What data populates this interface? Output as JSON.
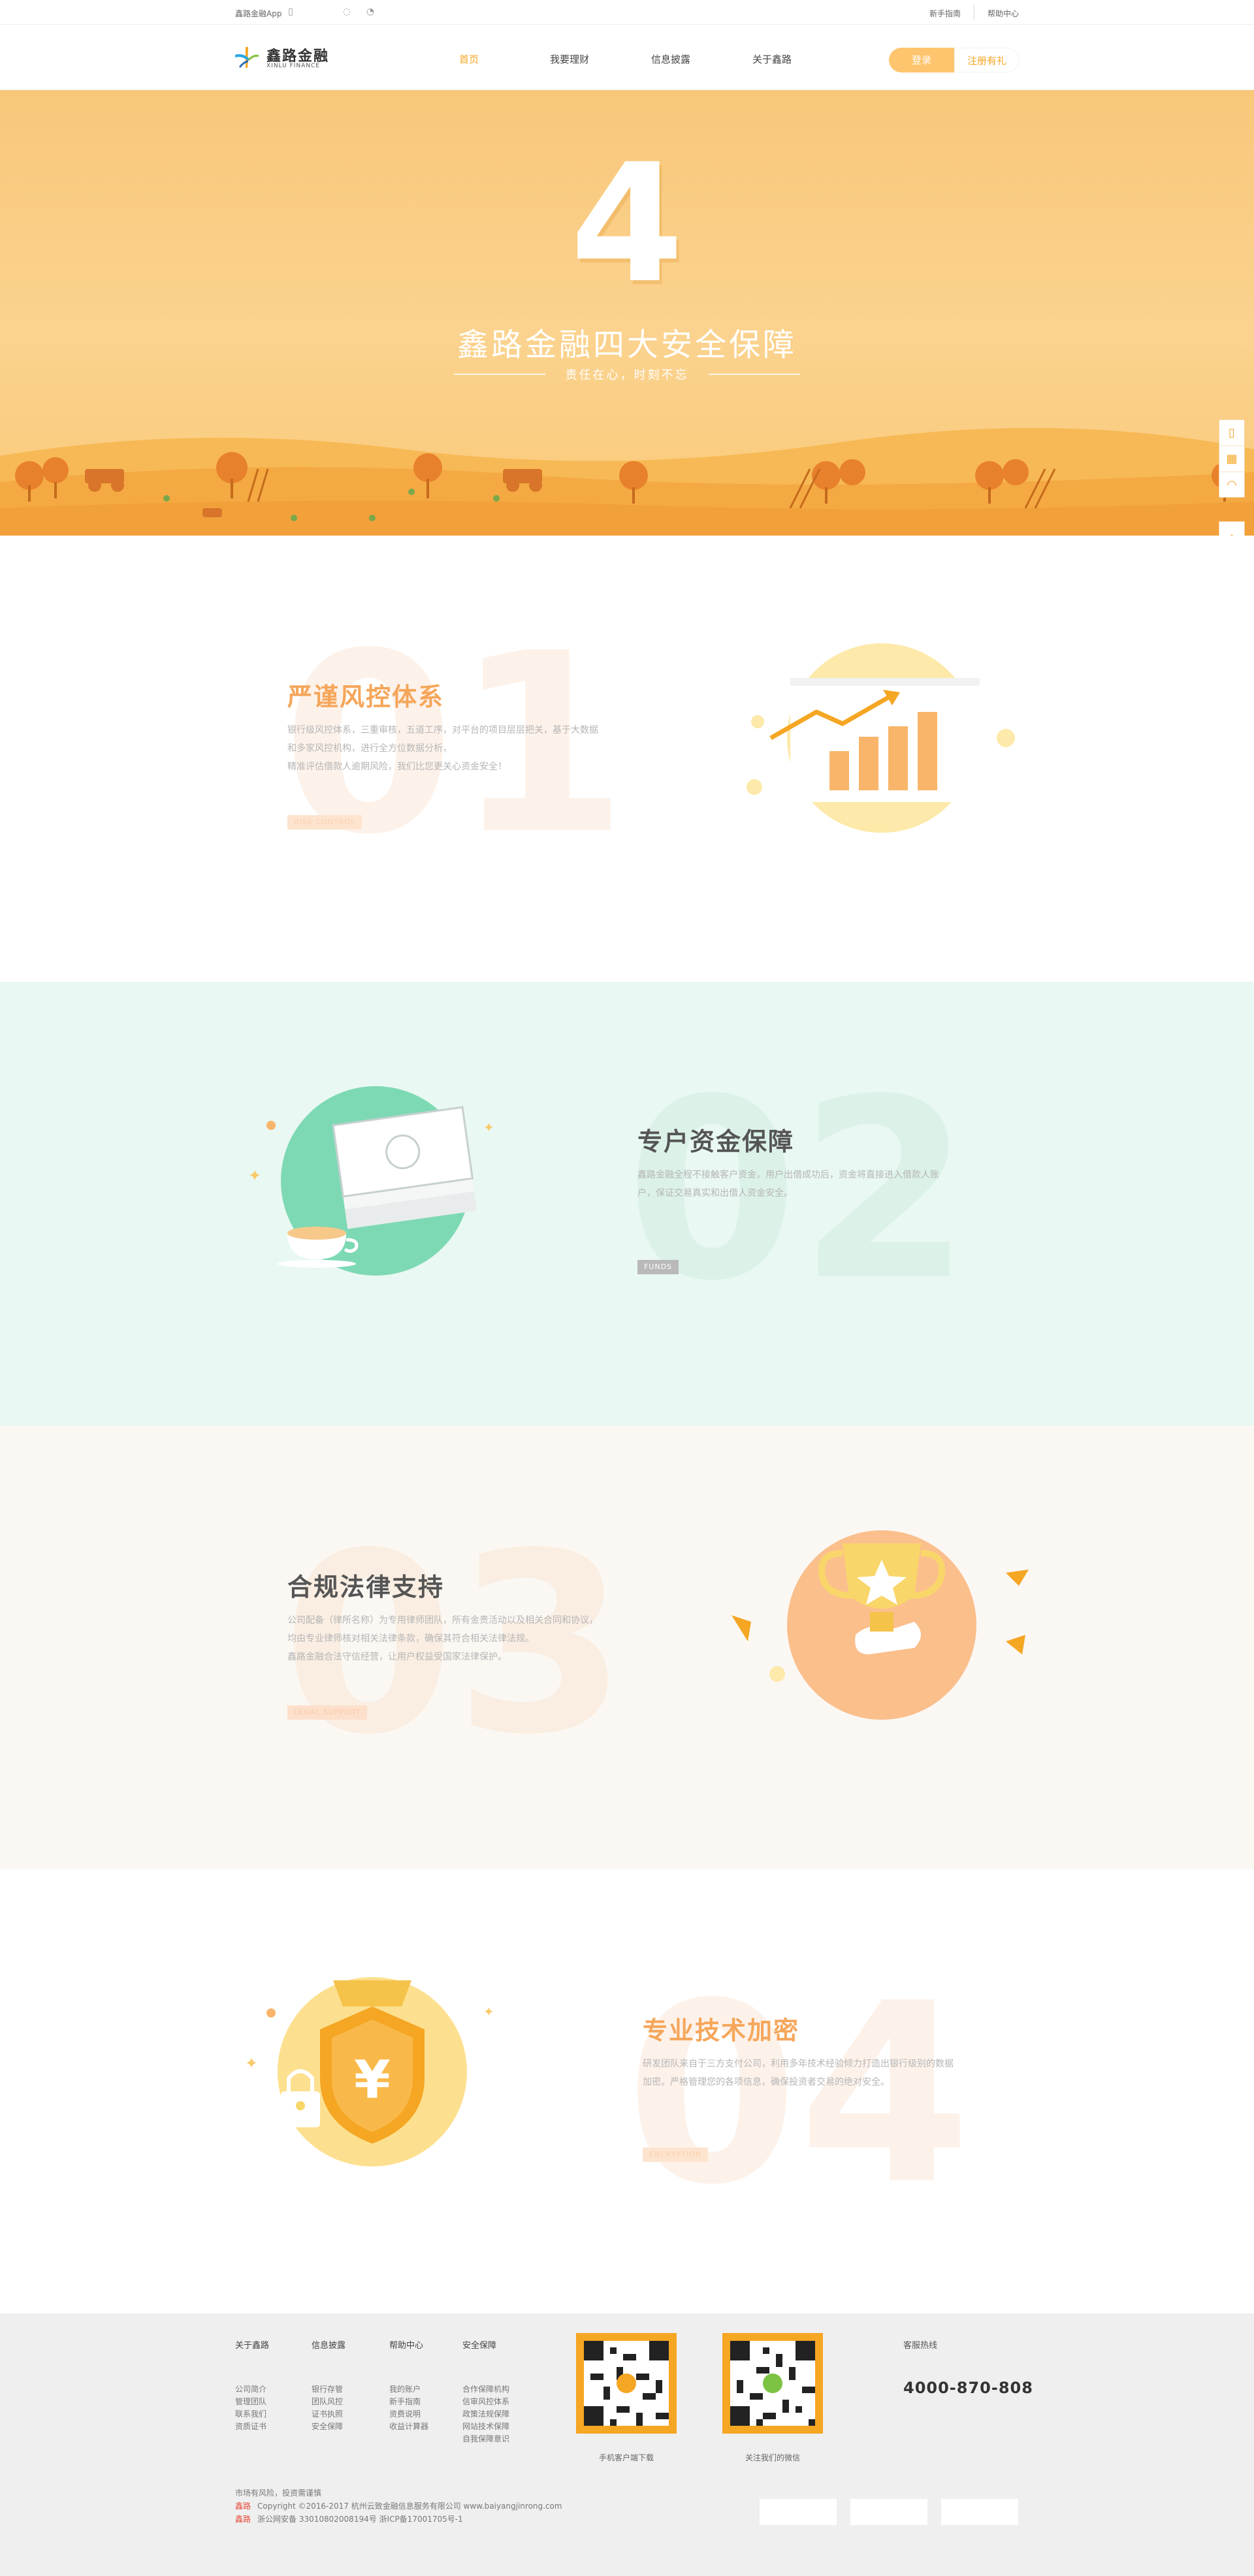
{
  "topbar": {
    "app_label": "鑫路金融App",
    "guide_label": "新手指南",
    "help_label": "帮助中心"
  },
  "header": {
    "logo_name": "鑫路金融",
    "logo_sub": "XINLU FINANCE",
    "nav": [
      "首页",
      "我要理财",
      "信息披露",
      "关于鑫路"
    ],
    "login_label": "登录",
    "register_label": "注册有礼"
  },
  "hero": {
    "number": "4",
    "title": "鑫路金融四大安全保障",
    "subtitle": "责任在心，时刻不忘"
  },
  "sections": [
    {
      "num": "01",
      "title": "严谨风控体系",
      "lines": [
        "银行级风控体系，三重审核，五道工序，对平台的项目层层把关，基于大数据",
        "和多家风控机构，进行全方位数据分析，",
        "精准评估借款人逾期风险，我们比您更关心资金安全！"
      ],
      "tag": "RISK CONTROL"
    },
    {
      "num": "02",
      "title": "专户资金保障",
      "lines": [
        "鑫路金融全程不接触客户资金，用户出借成功后，资金将直接进入借款人账",
        "户，保证交易真实和出借人资金安全。"
      ],
      "tag": "FUNDS"
    },
    {
      "num": "03",
      "title": "合规法律支持",
      "lines": [
        "公司配备（律所名称）为专用律师团队，所有金责活动以及相关合同和协议，",
        "均由专业律师核对相关法律条款，确保其符合相关法律法规。",
        "鑫路金融合法守信经营，让用户权益受国家法律保护。"
      ],
      "tag": "LEGAL SUPPORT"
    },
    {
      "num": "04",
      "title": "专业技术加密",
      "lines": [
        "研发团队来自于三方支付公司，利用多年技术经验倾力打造出银行级别的数据",
        "加密。严格管理您的各项信息，确保投资者交易的绝对安全。"
      ],
      "tag": "ENCRYPTION"
    }
  ],
  "footer": {
    "columns": [
      {
        "heading": "关于鑫路",
        "items": [
          "公司简介",
          "管理团队",
          "联系我们",
          "资质证书"
        ]
      },
      {
        "heading": "信息披露",
        "items": [
          "银行存管",
          "团队风控",
          "证书执照",
          "安全保障"
        ]
      },
      {
        "heading": "帮助中心",
        "items": [
          "我的账户",
          "新手指南",
          "资费说明",
          "收益计算器"
        ]
      },
      {
        "heading": "安全保障",
        "items": [
          "合作保障机构",
          "信审风控体系",
          "政策法规保障",
          "网站技术保障",
          "自我保障意识"
        ]
      }
    ],
    "qr_app_label": "手机客户端下载",
    "qr_wechat_label": "关注我们的微信",
    "hotline_heading": "客服热线",
    "hotline": "4000-870-808",
    "risk_note": "市场有风险，投资需谨慎",
    "copyright_prefix": "鑫路",
    "copyright": "Copyright ©2016-2017 杭州云致金融信息服务有限公司 www.baiyangjinrong.com",
    "icp_prefix": "鑫路",
    "icp": "浙公网安备 33010802008194号  浙ICP备17001705号-1"
  },
  "colors": {
    "accent": "#f5a623",
    "hero_bg": "#fbd38f",
    "mint_bg": "#e9f8f2",
    "cream_bg": "#fbf8f4",
    "footer_bg": "#efefef"
  }
}
